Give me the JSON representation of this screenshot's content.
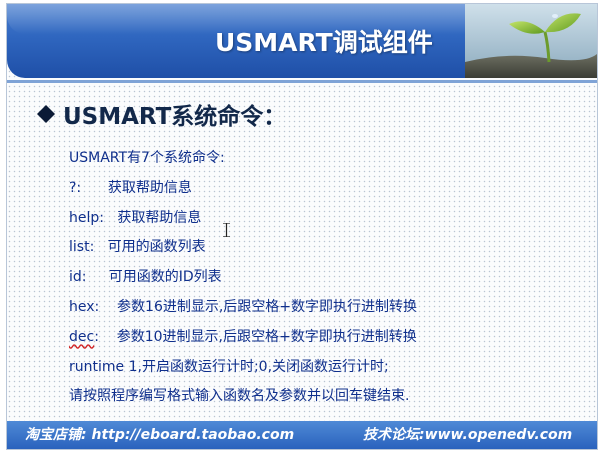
{
  "header": {
    "title": "USMART调试组件"
  },
  "heading": "USMART系统命令：",
  "lines": [
    "USMART有7个系统命令:",
    "?:      获取帮助信息",
    "help:   获取帮助信息",
    "list:   可用的函数列表",
    "id:     可用函数的ID列表",
    "hex:    参数16进制显示,后跟空格+数字即执行进制转换",
    "dec:    参数10进制显示,后跟空格+数字即执行进制转换",
    "runtime 1,开启函数运行计时;0,关闭函数运行计时;",
    "请按照程序编写格式输入函数名及参数并以回车键结束."
  ],
  "footer": {
    "left": "淘宝店铺: http://eboard.taobao.com",
    "right": "技术论坛:www.openedv.com"
  },
  "colors": {
    "header_blue": "#2f66bf",
    "text_blue": "#0f2f8c",
    "heading_navy": "#12284a"
  },
  "icons": [
    "diamond-bullet-icon",
    "sprout-image",
    "text-cursor-icon"
  ]
}
